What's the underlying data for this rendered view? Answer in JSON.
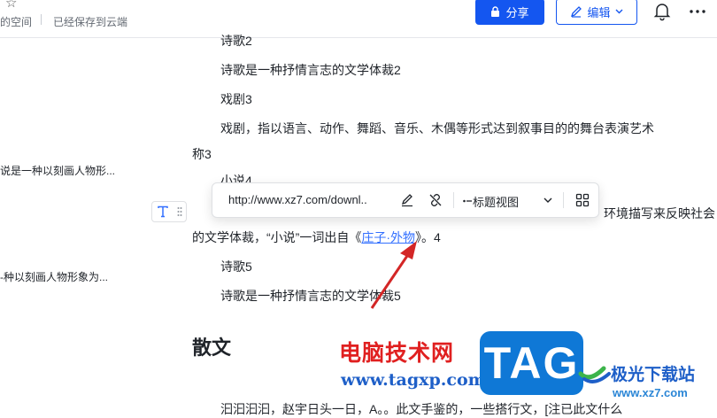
{
  "header": {
    "space_label": "的空间",
    "save_status": "已经保存到云端",
    "share_label": "分享",
    "edit_label": "编辑"
  },
  "outline": {
    "items": [
      "说是一种以刻画人物形...",
      "-种以刻画人物形象为..."
    ]
  },
  "doc": {
    "line1": "诗歌2",
    "line2": "诗歌是一种抒情言志的文学体裁2",
    "line3": "戏剧3",
    "line4": "戏剧，指以语言、动作、舞蹈、音乐、木偶等形式达到叙事目的的舞台表演艺术",
    "line5": "称3",
    "line6": "小说4",
    "line7_right": "环境描写来反映社会",
    "line8_pre": "的文学体裁，“小说”一词出自《",
    "line8_link": "庄子·外物",
    "line8_post": "》。4",
    "line9": "诗歌5",
    "line10": "诗歌是一种抒情言志的文学体裁5",
    "heading": "散文",
    "line11": "汩汩汩汩，赵宇日头一日，A。。此文手鉴的，一些搭行文，[注已此文什么"
  },
  "link_toolbar": {
    "url": "http://www.xz7.com/downl..",
    "view_label": "标题视图"
  },
  "watermark": {
    "cn": "电脑技术网",
    "url": "www.tagxp.com",
    "tag": "TAG",
    "jg_text": "极光下载站",
    "jg_url": "www.xz7.com"
  }
}
